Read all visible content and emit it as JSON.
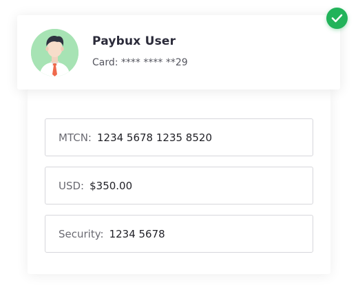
{
  "profile": {
    "name": "Paybux User",
    "card_label": "Card:",
    "card_value": "**** **** **29"
  },
  "status": {
    "icon": "check-icon",
    "color": "#22b35a"
  },
  "fields": {
    "mtcn": {
      "label": "MTCN:",
      "value": "1234 5678 1235 8520"
    },
    "usd": {
      "label": "USD:",
      "value": "$350.00"
    },
    "security": {
      "label": "Security:",
      "value": "1234 5678"
    }
  }
}
